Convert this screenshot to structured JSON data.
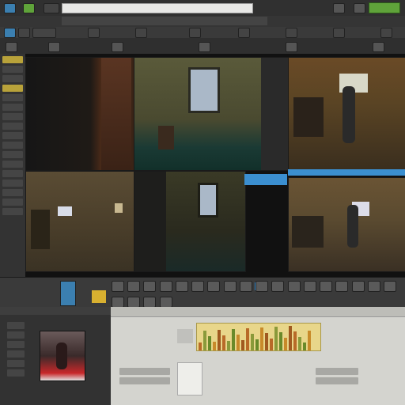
{
  "toolbar": {
    "search_placeholder": "",
    "status_text": ""
  },
  "colors": {
    "accent_blue": "#3b8fd0",
    "accent_green": "#5fa33a",
    "accent_yellow": "#d8b030",
    "panel": "#3a3a3a"
  },
  "icons": [
    "app-icon",
    "menu-icon",
    "view-icon",
    "search-icon",
    "record-icon",
    "play-icon",
    "folder-icon"
  ],
  "viewer": {
    "tiles": [
      {
        "name": "camera-1"
      },
      {
        "name": "camera-2"
      },
      {
        "name": "camera-3"
      },
      {
        "name": "camera-4"
      },
      {
        "name": "camera-5"
      },
      {
        "name": "camera-6"
      }
    ]
  },
  "timeline": {
    "clip_count": 24
  }
}
